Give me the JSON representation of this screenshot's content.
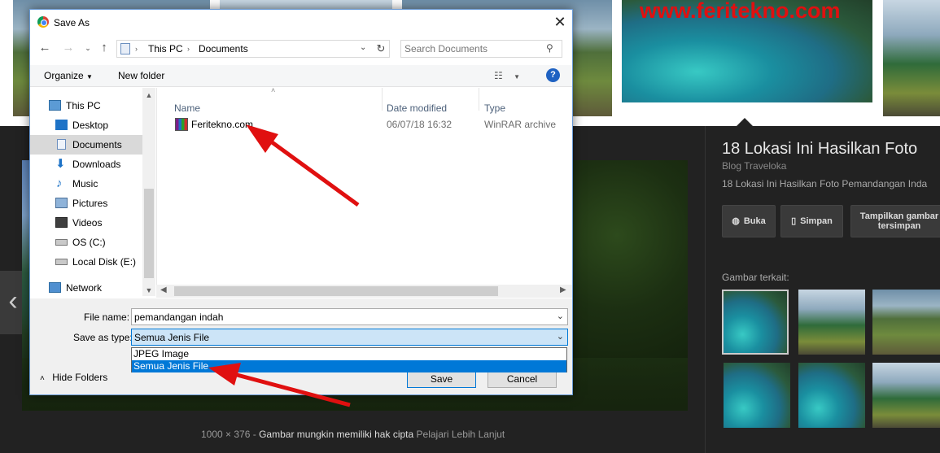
{
  "background": {
    "watermark": "www.feritekno.com",
    "side_panel": {
      "title": "18 Lokasi Ini Hasilkan Foto",
      "source": "Blog Traveloka",
      "description": "18 Lokasi Ini Hasilkan Foto Pemandangan Inda",
      "buttons": {
        "visit": "Buka",
        "save": "Simpan",
        "view_saved": "Tampilkan gambar tersimpan"
      },
      "related_label": "Gambar terkait:"
    },
    "caption": {
      "dimensions": "1000 × 376",
      "separator": "-",
      "copyright": "Gambar mungkin memiliki hak cipta",
      "learn_more": "Pelajari Lebih Lanjut"
    }
  },
  "dialog": {
    "title": "Save As",
    "close": "✕",
    "address": {
      "segments": [
        "This PC",
        "Documents"
      ]
    },
    "search": {
      "placeholder": "Search Documents"
    },
    "toolbar": {
      "organize": "Organize",
      "new_folder": "New folder"
    },
    "nav": {
      "items": [
        {
          "label": "This PC",
          "icon": "computer-icon"
        },
        {
          "label": "Desktop",
          "icon": "desktop-icon"
        },
        {
          "label": "Documents",
          "icon": "documents-icon",
          "selected": true
        },
        {
          "label": "Downloads",
          "icon": "download-icon"
        },
        {
          "label": "Music",
          "icon": "music-icon"
        },
        {
          "label": "Pictures",
          "icon": "pictures-icon"
        },
        {
          "label": "Videos",
          "icon": "videos-icon"
        },
        {
          "label": "OS (C:)",
          "icon": "drive-icon"
        },
        {
          "label": "Local Disk (E:)",
          "icon": "drive-icon"
        },
        {
          "label": "Network",
          "icon": "network-icon"
        }
      ]
    },
    "columns": {
      "name": "Name",
      "date_modified": "Date modified",
      "type": "Type"
    },
    "files": [
      {
        "name": "Feritekno.com",
        "date": "06/07/18 16:32",
        "type": "WinRAR archive"
      }
    ],
    "file_name_label": "File name:",
    "file_name_value": "pemandangan indah",
    "save_as_type_label": "Save as type:",
    "save_as_type_value": "Semua Jenis File",
    "type_options": [
      "JPEG Image",
      "Semua Jenis File"
    ],
    "hide_folders": "Hide Folders",
    "save_button": "Save",
    "cancel_button": "Cancel"
  },
  "colors": {
    "accent": "#0078d7",
    "annotation_arrow": "#e01010",
    "link": "#1e3287"
  }
}
